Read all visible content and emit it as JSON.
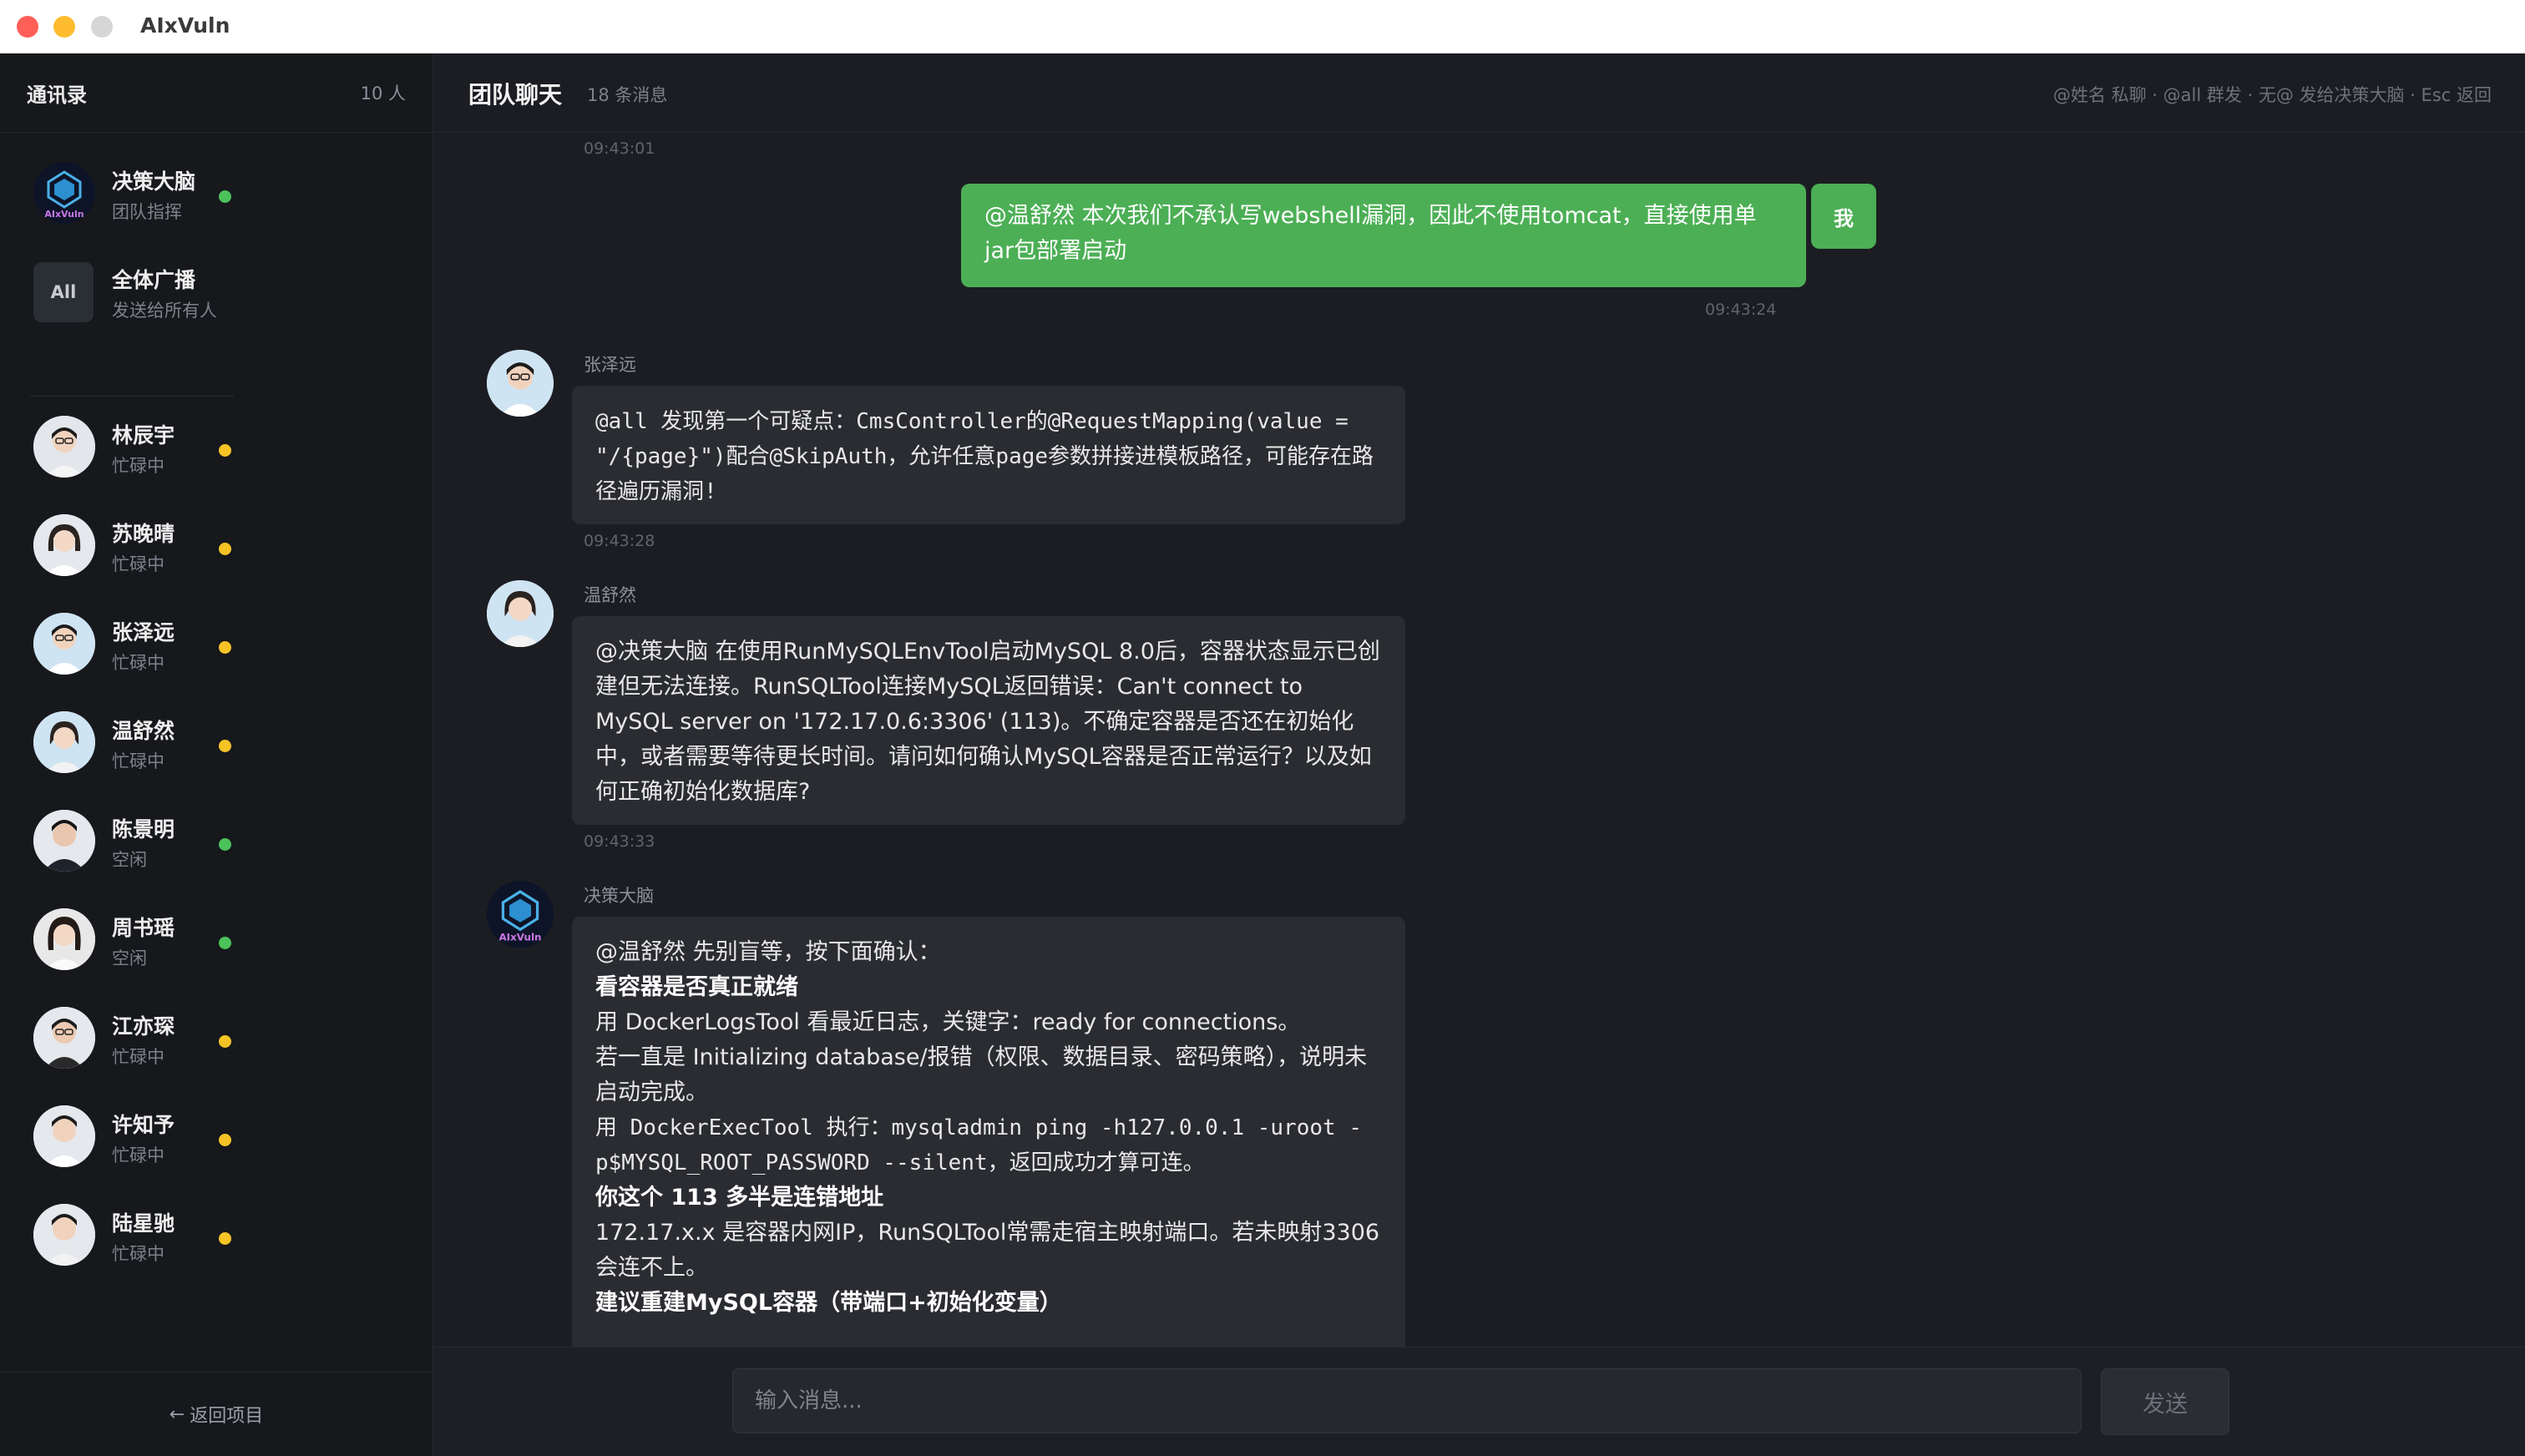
{
  "window": {
    "title": "AIxVuln"
  },
  "sidebar": {
    "title": "通讯录",
    "count": "10 人",
    "back_label": "返回项目",
    "contacts": [
      {
        "name": "决策大脑",
        "status": "团队指挥",
        "dot_color": "#4cc25a",
        "avatar": "logo-icon"
      },
      {
        "name": "全体广播",
        "status": "发送给所有人",
        "avatar_text": "All"
      },
      {
        "name": "林辰宇",
        "status": "忙碌中",
        "dot_color": "#f5c325"
      },
      {
        "name": "苏晚晴",
        "status": "忙碌中",
        "dot_color": "#f5c325"
      },
      {
        "name": "张泽远",
        "status": "忙碌中",
        "dot_color": "#f5c325"
      },
      {
        "name": "温舒然",
        "status": "忙碌中",
        "dot_color": "#f5c325"
      },
      {
        "name": "陈景明",
        "status": "空闲",
        "dot_color": "#4cc25a"
      },
      {
        "name": "周书瑶",
        "status": "空闲",
        "dot_color": "#4cc25a"
      },
      {
        "name": "江亦琛",
        "status": "忙碌中",
        "dot_color": "#f5c325"
      },
      {
        "name": "许知予",
        "status": "忙碌中",
        "dot_color": "#f5c325"
      },
      {
        "name": "陆星驰",
        "status": "忙碌中",
        "dot_color": "#f5c325"
      }
    ]
  },
  "chat": {
    "title": "团队聊天",
    "count": "18 条消息",
    "hint": "@姓名 私聊 · @all 群发 · 无@ 发给决策大脑 · Esc 返回",
    "messages": [
      {
        "time": "09:43:01"
      },
      {
        "from": "我",
        "text": "@温舒然 本次我们不承认写webshell漏洞，因此不使用tomcat，直接使用单jar包部署启动",
        "time": "09:43:24"
      },
      {
        "from": "张泽远",
        "text": "@all 发现第一个可疑点：CmsController的@RequestMapping(value = \"/{page}\")配合@SkipAuth，允许任意page参数拼接进模板路径，可能存在路径遍历漏洞!",
        "time": "09:43:28"
      },
      {
        "from": "温舒然",
        "text": "@决策大脑 在使用RunMySQLEnvTool启动MySQL 8.0后，容器状态显示已创建但无法连接。RunSQLTool连接MySQL返回错误：Can't connect to MySQL server on '172.17.0.6:3306' (113)。不确定容器是否还在初始化中，或者需要等待更长时间。请问如何确认MySQL容器是否正常运行？以及如何正确初始化数据库?",
        "time": "09:43:33"
      },
      {
        "from": "决策大脑",
        "lines": [
          "@温舒然 先别盲等，按下面确认：",
          "看容器是否真正就绪",
          "用 DockerLogsTool 看最近日志，关键字：ready for connections。",
          "若一直是 Initializing database/报错（权限、数据目录、密码策略），说明未启动完成。",
          "用 DockerExecTool 执行：mysqladmin ping -h127.0.0.1 -uroot -p$MYSQL_ROOT_PASSWORD --silent，返回成功才算可连。",
          "你这个 113 多半是连错地址",
          "172.17.x.x 是容器内网IP，RunSQLTool常需走宿主映射端口。若未映射3306会连不上。",
          "建议重建MySQL容器（带端口+初始化变量）"
        ]
      }
    ]
  },
  "input": {
    "placeholder": "输入消息...",
    "send_label": "发送"
  }
}
